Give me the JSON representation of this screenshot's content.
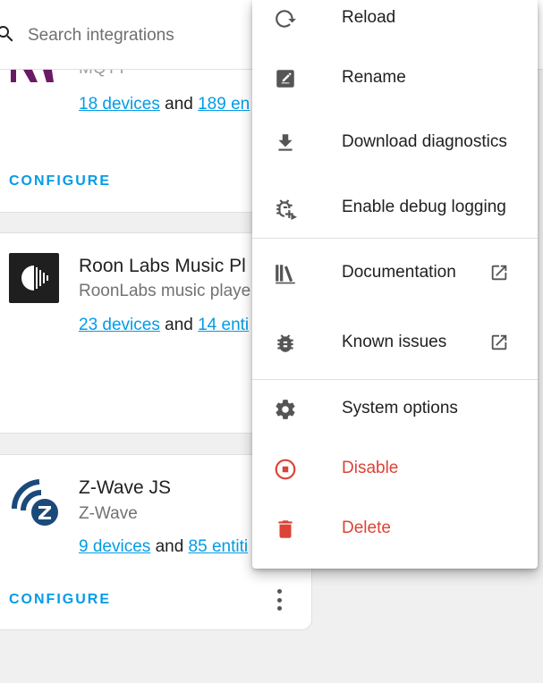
{
  "search": {
    "placeholder": "Search integrations"
  },
  "cards": [
    {
      "id": "mqtt",
      "title": "MQTT",
      "devices_link": "18 devices",
      "and": "and",
      "entities_link": "189 en",
      "configure": "CONFIGURE"
    },
    {
      "id": "roon",
      "title": "Roon Labs Music Pl",
      "subtitle": "RoonLabs music playe",
      "devices_link": "23 devices",
      "and": "and",
      "entities_link": "14 enti"
    },
    {
      "id": "zwave",
      "title": "Z-Wave JS",
      "subtitle": "Z-Wave",
      "devices_link": "9 devices",
      "and": "and",
      "entities_link": "85 entiti",
      "configure": "CONFIGURE"
    }
  ],
  "menu": {
    "items": [
      {
        "label": "Reload",
        "icon": "reload-icon"
      },
      {
        "label": "Rename",
        "icon": "rename-icon"
      },
      {
        "label": "Download diagnostics",
        "icon": "download-icon"
      },
      {
        "label": "Enable debug logging",
        "icon": "bug-play-icon"
      },
      {
        "label": "Documentation",
        "icon": "library-icon",
        "external": true
      },
      {
        "label": "Known issues",
        "icon": "bug-icon",
        "external": true
      },
      {
        "label": "System options",
        "icon": "gear-icon"
      },
      {
        "label": "Disable",
        "icon": "stop-circle-icon",
        "danger": true
      },
      {
        "label": "Delete",
        "icon": "trash-icon",
        "danger": true
      }
    ]
  },
  "colors": {
    "link": "#039be5",
    "danger": "#db4437",
    "icon": "#555555",
    "background": "#f0f0f0"
  }
}
